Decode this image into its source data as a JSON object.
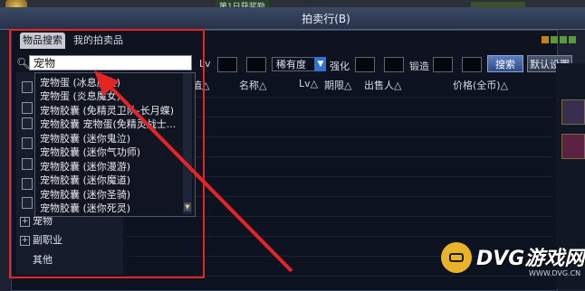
{
  "window": {
    "title": "拍卖行(B)",
    "top_label": "第1日获奖励"
  },
  "tabs": [
    {
      "label": "物品搜索"
    },
    {
      "label": "我的拍卖品"
    }
  ],
  "search": {
    "value": "宠物"
  },
  "dropdown": {
    "items": [
      "宠物蛋 (冰息魔女)",
      "宠物蛋 (炎息魔女)",
      "宠物胶囊 (免精灵卫队-长月蝶)",
      "宠物胶囊 宠物蛋(免精灵战士...",
      "宠物胶囊 (迷你鬼泣)",
      "宠物胶囊 (迷你气功师)",
      "宠物胶囊 (迷你漫游)",
      "宠物胶囊 (迷你魔道)",
      "宠物胶囊 (迷你圣骑)",
      "宠物胶囊 (迷你死灵)"
    ]
  },
  "categories": [
    {
      "label": "宠物"
    },
    {
      "label": "副职业"
    },
    {
      "label": "其他"
    }
  ],
  "filters": {
    "lv": "Lv",
    "rarity": "稀有度",
    "enhance": "强化",
    "forge": "锻造"
  },
  "buttons": {
    "search": "搜索",
    "default_settings": "默认设置"
  },
  "columns": [
    "值△",
    "名称△",
    "Lv△",
    "期限△",
    "出售人△",
    "价格(全币)△"
  ],
  "watermark": {
    "name": "DVG游戏网",
    "url": "WWW.DVG.CN"
  },
  "colors": {
    "annotation": "#e52525",
    "search_button": "#3d62a8",
    "watermark": "#e8b22a"
  }
}
